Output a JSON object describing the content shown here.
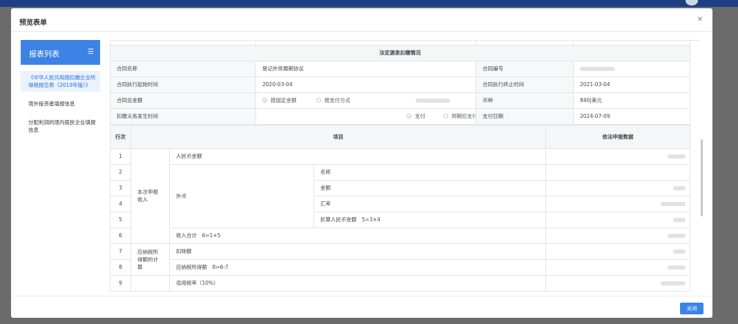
{
  "modal": {
    "title": "预览表单",
    "close_label": "关闭"
  },
  "sidebar": {
    "title": "报表列表",
    "items": [
      "《中华人民共和国扣缴企业所得税报告表（2019年版）》",
      "境外投资者填报信息",
      "分配利润的境内居民企业填报信息"
    ]
  },
  "contract": {
    "section_title": "法定源泉扣缴情况",
    "rows": [
      {
        "l1": "合同名称",
        "v1": "登记外债展期协议",
        "l2": "合同编号",
        "v2": ""
      },
      {
        "l1": "合同执行起始时间",
        "v1": "2020-03-04",
        "l2": "合同执行终止时间",
        "v2": "2021-03-04"
      }
    ],
    "amount_label": "合同总金额",
    "amount_options": [
      "按固定金额",
      "按支付方式"
    ],
    "currency_label": "币种",
    "currency_value": "840|美元",
    "obligation_label": "扣缴义务发生时间",
    "obligation_options": [
      "支付",
      "到期应支付"
    ],
    "pay_date_label": "支付日期",
    "pay_date_value": "2024-07-09"
  },
  "report": {
    "headers": {
      "line": "行次",
      "item": "项目",
      "data": "依法申报数据"
    },
    "group_income": "本次申报收入",
    "group_taxable": "应纳税所得额的计算",
    "rows": [
      {
        "n": "1",
        "item": "人民币金额"
      },
      {
        "n": "2",
        "item": "名称"
      },
      {
        "n": "3",
        "item": "金额"
      },
      {
        "n": "4",
        "item": "汇率"
      },
      {
        "n": "5",
        "item": "折算人民币金额　5=3×4"
      },
      {
        "n": "6",
        "item": "收入合计　6=1+5"
      },
      {
        "n": "7",
        "item": "扣除额"
      },
      {
        "n": "8",
        "item": "应纳税所得额　8=6-7"
      },
      {
        "n": "9",
        "item": "适用税率（10%）"
      }
    ],
    "foreign_label": "外币"
  },
  "colors": {
    "accent": "#3d83e6",
    "header_bar": "#1c3f86"
  },
  "icons": {
    "menu": "list-icon",
    "close": "close-icon"
  }
}
